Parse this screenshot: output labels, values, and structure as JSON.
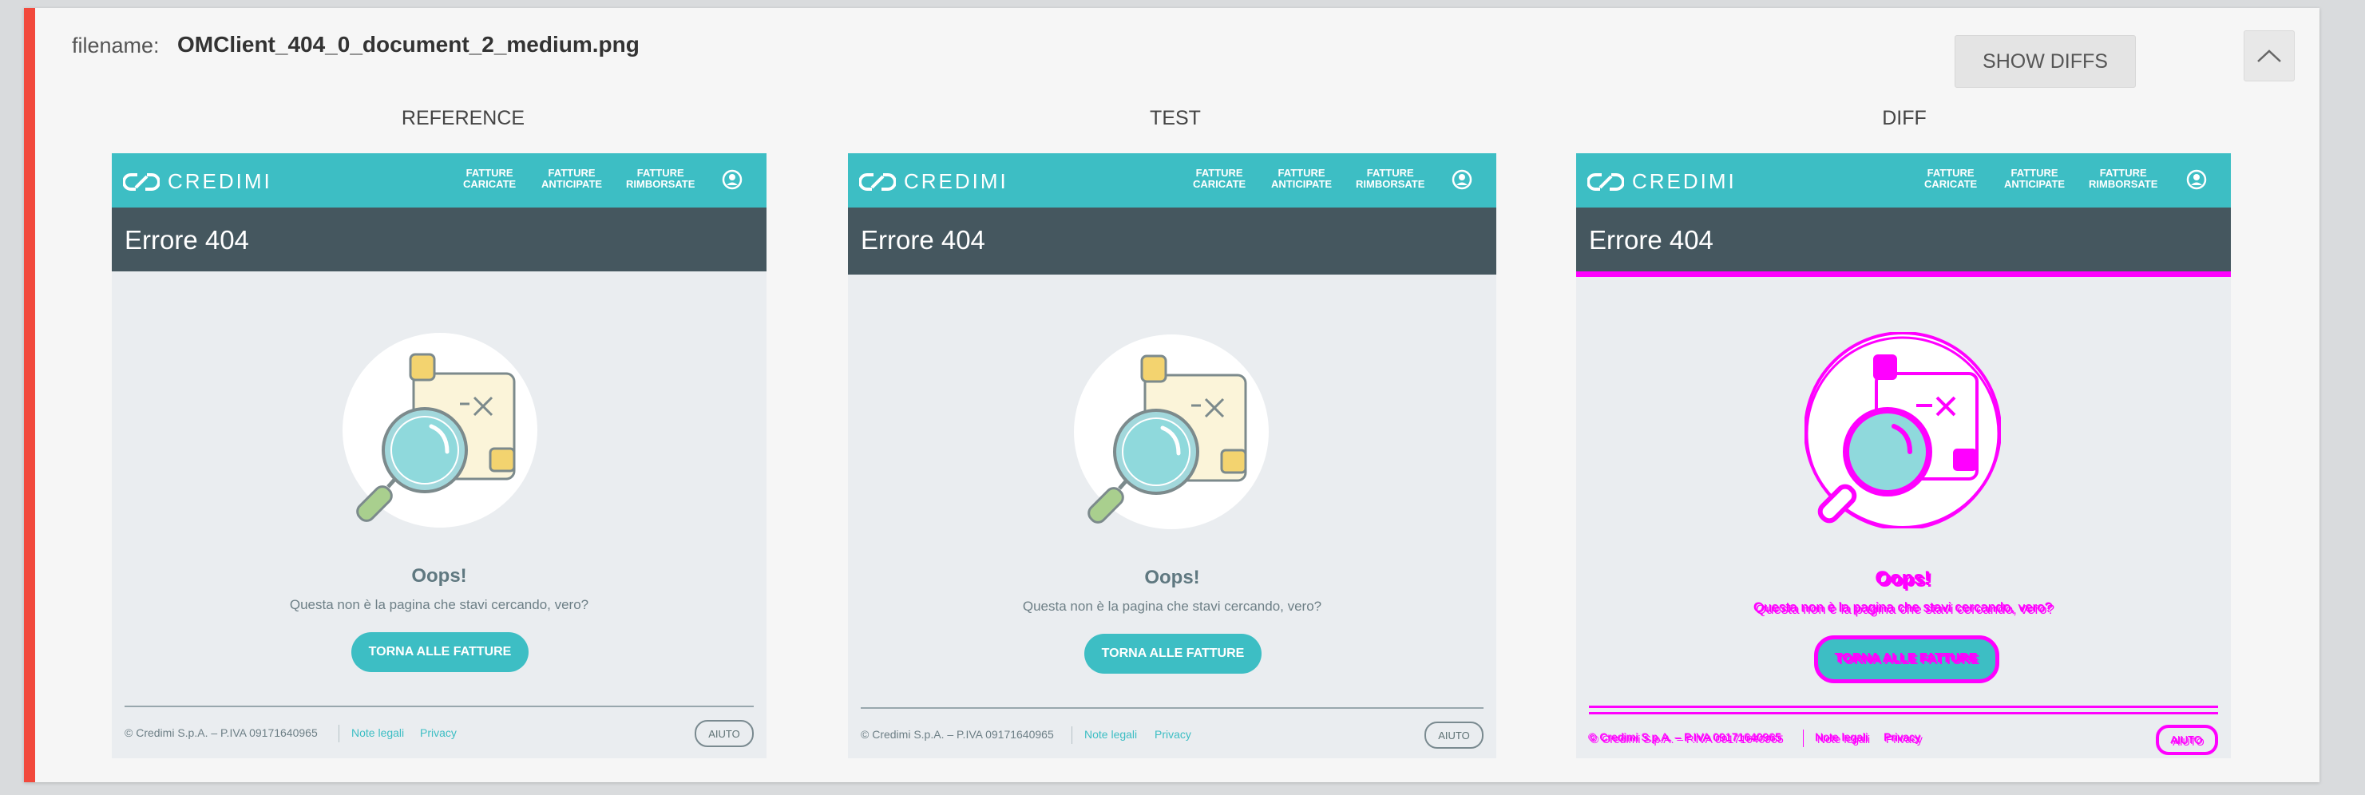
{
  "header": {
    "filename_label": "filename:",
    "filename_value": "OMClient_404_0_document_2_medium.png",
    "show_diffs_label": "SHOW DIFFS"
  },
  "columns": {
    "reference": "REFERENCE",
    "test": "TEST",
    "diff": "DIFF"
  },
  "app": {
    "brand": "CREDIMI",
    "nav": [
      {
        "line1": "FATTURE",
        "line2": "CARICATE"
      },
      {
        "line1": "FATTURE",
        "line2": "ANTICIPATE"
      },
      {
        "line1": "FATTURE",
        "line2": "RIMBORSATE"
      }
    ],
    "page_title": "Errore 404",
    "oops": "Oops!",
    "message": "Questa non è la pagina che stavi cercando, vero?",
    "cta": "TORNA ALLE FATTURE",
    "footer": {
      "copyright": "© Credimi S.p.A. – P.IVA 09171640965",
      "legal": "Note legali",
      "privacy": "Privacy",
      "help": "AIUTO"
    }
  },
  "colors": {
    "accent": "#3dbec4",
    "header": "#45575f",
    "diff": "#ff00ff",
    "failure_bar": "#f2493c"
  },
  "icons": [
    "chevron-up-icon",
    "credimi-logo-icon",
    "user-icon",
    "document-search-illustration"
  ]
}
